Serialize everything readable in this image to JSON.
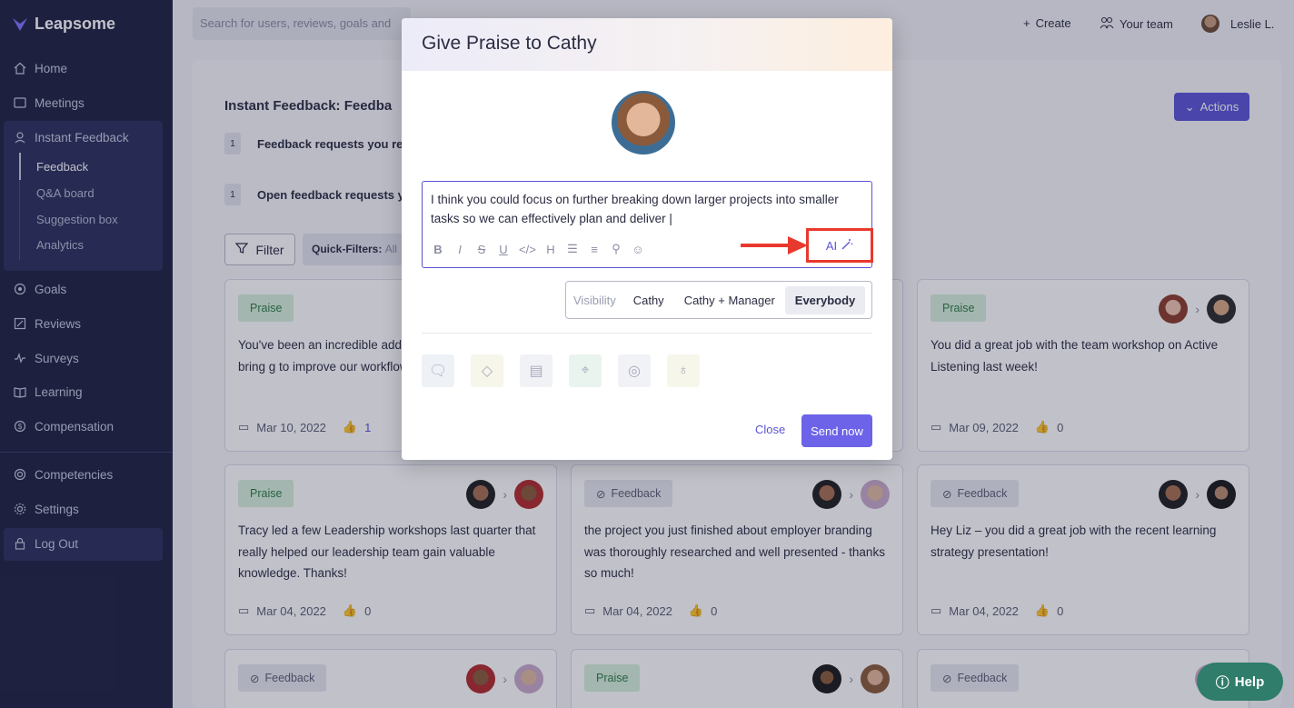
{
  "app": {
    "logo": "Leapsome"
  },
  "sidebar": {
    "items": [
      {
        "label": "Home",
        "icon": "home-icon"
      },
      {
        "label": "Meetings",
        "icon": "meetings-icon"
      },
      {
        "label": "Instant Feedback",
        "icon": "feedback-icon"
      },
      {
        "label": "Goals",
        "icon": "goals-icon"
      },
      {
        "label": "Reviews",
        "icon": "reviews-icon"
      },
      {
        "label": "Surveys",
        "icon": "surveys-icon"
      },
      {
        "label": "Learning",
        "icon": "learning-icon"
      },
      {
        "label": "Compensation",
        "icon": "compensation-icon"
      },
      {
        "label": "Competencies",
        "icon": "competencies-icon"
      },
      {
        "label": "Settings",
        "icon": "settings-icon"
      },
      {
        "label": "Log Out",
        "icon": "lock-icon"
      }
    ],
    "sub_items": [
      "Feedback",
      "Q&A board",
      "Suggestion box",
      "Analytics"
    ]
  },
  "topbar": {
    "search_placeholder": "Search for users, reviews, goals and",
    "create": "Create",
    "your_team": "Your team",
    "user": "Leslie L."
  },
  "main": {
    "title": "Instant Feedback: Feedba",
    "actions": "Actions",
    "requests": [
      {
        "count": "1",
        "label": "Feedback requests you re"
      },
      {
        "count": "1",
        "label": "Open feedback requests y"
      }
    ],
    "filter": "Filter",
    "quick_filters_label": "Quick-Filters:",
    "quick_filters_value": "All"
  },
  "cards": [
    {
      "tag": "Praise",
      "text": "You've been an incredible add engineering team - you bring g to improve our workflows and",
      "date": "Mar 10, 2022",
      "likes": "1"
    },
    {
      "tag": "Praise",
      "text": "You did a great job with the team workshop on Active Listening last week!",
      "date": "Mar 09, 2022",
      "likes": "0"
    },
    {
      "tag": "Praise",
      "text": "Tracy led a few Leadership workshops last quarter that really helped our leadership team gain valuable knowledge. Thanks!",
      "date": "Mar 04, 2022",
      "likes": "0"
    },
    {
      "tag": "Feedback",
      "text": "the project you just finished about employer branding was thoroughly researched and well presented - thanks so much!",
      "date": "Mar 04, 2022",
      "likes": "0"
    },
    {
      "tag": "Feedback",
      "text": "Hey Liz – you did a great job with the recent learning strategy presentation!",
      "date": "Mar 04, 2022",
      "likes": "0"
    },
    {
      "tag": "Feedback"
    },
    {
      "tag": "Praise"
    },
    {
      "tag": "Feedback"
    }
  ],
  "modal": {
    "title": "Give Praise to Cathy",
    "message": "I think you could focus on further breaking down larger projects into smaller tasks so we can effectively plan and deliver",
    "ai_label": "AI",
    "visibility_label": "Visibility",
    "visibility_options": [
      "Cathy",
      "Cathy + Manager",
      "Everybody"
    ],
    "visibility_selected": "Everybody",
    "close": "Close",
    "send": "Send now"
  },
  "help": "Help",
  "colors": {
    "accent": "#5b54d6",
    "sidebar": "#1f2142",
    "annotation": "#e8392d",
    "help": "#2f7d6a"
  }
}
